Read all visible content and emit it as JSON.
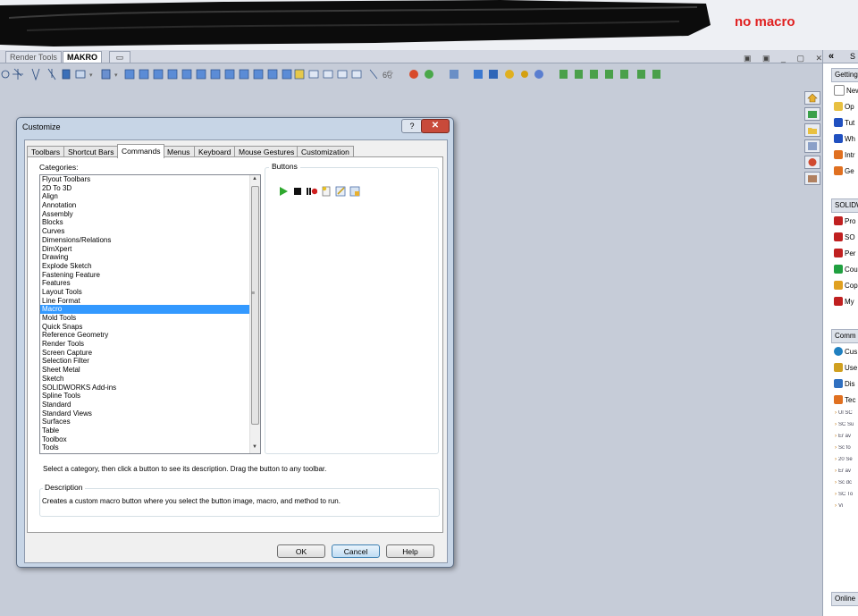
{
  "annotation": "no macro",
  "command_tabs": {
    "render_tools": "Render Tools",
    "makro": "MAKRO"
  },
  "window_controls": "▣ ▣ _ ▢ ✕",
  "taskpane": {
    "collapse": "«",
    "header_letter": "S",
    "sections": [
      {
        "title": "Getting",
        "items": [
          "New",
          "Op",
          "Tut",
          "Wh",
          "Intr",
          "Ge"
        ],
        "colors": [
          "#ffffff",
          "#e8c040",
          "#2050c0",
          "#2050c0",
          "#e07020",
          "#e07020"
        ]
      },
      {
        "title": "SOLIDW",
        "items": [
          "Pro",
          "SO",
          "Per",
          "Cou",
          "Cop",
          "My"
        ],
        "colors": [
          "#c02020",
          "#c02020",
          "#c02020",
          "#20a040",
          "#e0a020",
          "#c02020"
        ]
      },
      {
        "title": "Comm",
        "items": [
          "Cus",
          "Use",
          "Dis",
          "Tec"
        ],
        "colors": [
          "#2080c0",
          "#d0a020",
          "#3070c0",
          "#e07020"
        ]
      }
    ],
    "news": [
      "Ul SC",
      "SC Su",
      "Er av",
      "Sc fo",
      "20 Se",
      "Er av",
      "Sc dc",
      "SC To",
      "Vi"
    ],
    "online": "Online"
  },
  "dialog": {
    "title": "Customize",
    "help_glyph": "?",
    "close_glyph": "✕",
    "tabs": [
      "Toolbars",
      "Shortcut Bars",
      "Commands",
      "Menus",
      "Keyboard",
      "Mouse Gestures",
      "Customization"
    ],
    "categories_label": "Categories:",
    "categories": [
      "Flyout Toolbars",
      "2D To 3D",
      "Align",
      "Annotation",
      "Assembly",
      "Blocks",
      "Curves",
      "Dimensions/Relations",
      "DimXpert",
      "Drawing",
      "Explode Sketch",
      "Fastening Feature",
      "Features",
      "Layout Tools",
      "Line Format",
      "Macro",
      "Mold Tools",
      "Quick Snaps",
      "Reference Geometry",
      "Render Tools",
      "Screen Capture",
      "Selection Filter",
      "Sheet Metal",
      "Sketch",
      "SOLIDWORKS Add-ins",
      "Spline Tools",
      "Standard",
      "Standard Views",
      "Surfaces",
      "Table",
      "Toolbox",
      "Tools"
    ],
    "selected_category": "Macro",
    "buttons_label": "Buttons",
    "macro_buttons": [
      "run-macro-icon",
      "stop-macro-icon",
      "record-pause-macro-icon",
      "new-macro-icon",
      "edit-macro-icon",
      "custom-macro-icon"
    ],
    "hint": "Select a category, then click a button to see its description. Drag the button to any toolbar.",
    "description_label": "Description",
    "description": "Creates a custom macro button where you select the button image, macro, and method to run.",
    "ok": "OK",
    "cancel": "Cancel",
    "help": "Help"
  }
}
